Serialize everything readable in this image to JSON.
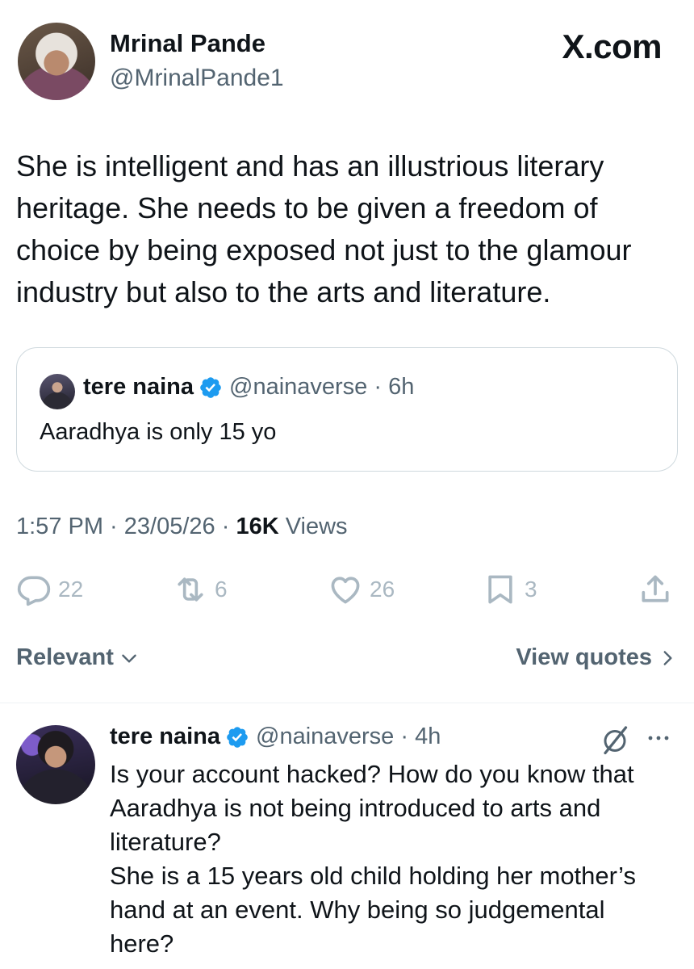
{
  "author": {
    "name": "Mrinal Pande",
    "handle": "@MrinalPande1"
  },
  "brand": "X.com",
  "tweet": {
    "text": "She is intelligent and has an illustrious literary heritage. She needs to be given a freedom of choice by being exposed not just to the glamour industry but also to the arts and literature."
  },
  "quote": {
    "name": "tere naina",
    "handle_time": "@nainaverse · 6h",
    "text": "Aaradhya is only 15 yo"
  },
  "meta": {
    "time_date": "1:57 PM · 23/05/26 · ",
    "views_count": "16K",
    "views_label": " Views"
  },
  "actions": {
    "replies": "22",
    "reposts": "6",
    "likes": "26",
    "bookmarks": "3"
  },
  "filters": {
    "relevant": "Relevant",
    "view_quotes": "View quotes"
  },
  "reply": {
    "name": "tere naina",
    "handle_time": "@nainaverse · 4h",
    "lines": [
      "Is your account hacked? How do you know that Aaradhya is not being introduced to arts and literature?",
      "She is a 15 years old child holding her mother’s hand at an event. Why being so judgemental here?"
    ]
  },
  "colors": {
    "text": "#0f1419",
    "secondary": "#536471",
    "action_icons": "#aab8c2",
    "verified": "#1d9bf0",
    "border": "#cfd9de"
  },
  "icons": [
    "verified-badge-icon",
    "reply-icon",
    "repost-icon",
    "like-icon",
    "bookmark-icon",
    "share-icon",
    "chevron-down-icon",
    "chevron-right-icon",
    "grok-icon",
    "more-icon"
  ]
}
